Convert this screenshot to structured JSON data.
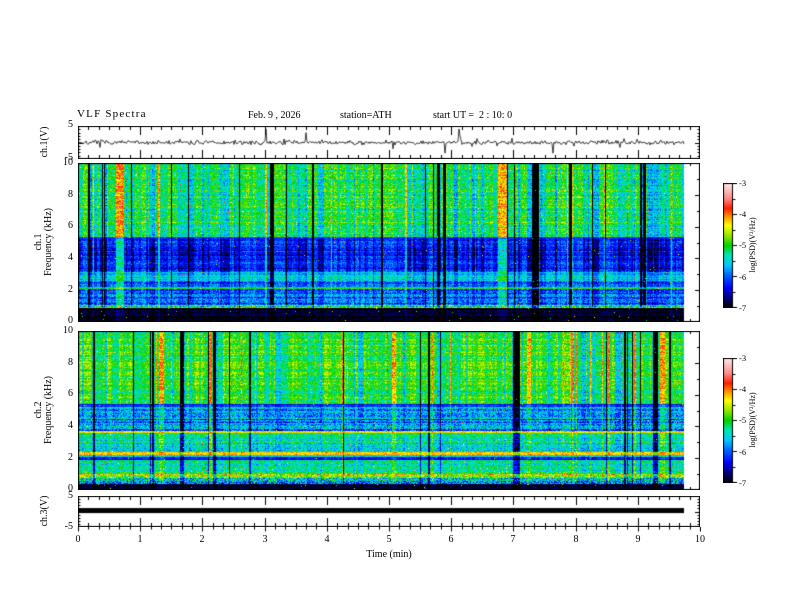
{
  "header": {
    "title": "VLF Spectra",
    "date": "Feb. 9 , 2026",
    "station": "station=ATH",
    "start_ut": "start UT =  2 : 10: 0"
  },
  "axes": {
    "time_label": "Time (min)",
    "x_ticks": [
      "0",
      "1",
      "2",
      "3",
      "4",
      "5",
      "6",
      "7",
      "8",
      "9",
      "10"
    ],
    "x_range_min": [
      0,
      10
    ],
    "x_minor_intervals_per_major": 6,
    "data_end_min": 9.75
  },
  "panels": {
    "wave1": {
      "ylabel": "ch.1(V)",
      "yticks": [
        "5",
        "-5"
      ],
      "yrange_V": [
        -5,
        5
      ]
    },
    "spec1": {
      "ylabel_line1": "ch.1",
      "ylabel_line2": "Frequency (kHz)",
      "yticks": [
        "10",
        "8",
        "6",
        "4",
        "2",
        "0"
      ],
      "yrange_kHz": [
        0,
        10
      ]
    },
    "spec2": {
      "ylabel_line1": "ch.2",
      "ylabel_line2": "Frequency (kHz)",
      "yticks": [
        "10",
        "8",
        "6",
        "4",
        "2",
        "0"
      ],
      "yrange_kHz": [
        0,
        10
      ]
    },
    "wave3": {
      "ylabel": "ch.3(V)",
      "yticks": [
        "5",
        "-5"
      ],
      "yrange_V": [
        -5,
        5
      ]
    }
  },
  "colorbar": {
    "label": "log(PSD)(V²/Hz)",
    "ticks": [
      "-3",
      "-4",
      "-5",
      "-6",
      "-7"
    ],
    "range": [
      -3,
      -7
    ],
    "palette": [
      [
        0.0,
        "#000000"
      ],
      [
        0.07,
        "#000070"
      ],
      [
        0.16,
        "#0000ff"
      ],
      [
        0.26,
        "#0064ff"
      ],
      [
        0.34,
        "#00c8ff"
      ],
      [
        0.42,
        "#00e6b4"
      ],
      [
        0.5,
        "#00d200"
      ],
      [
        0.58,
        "#96e600"
      ],
      [
        0.66,
        "#ffff00"
      ],
      [
        0.73,
        "#ff9600"
      ],
      [
        0.8,
        "#ff1e00"
      ],
      [
        0.88,
        "#ff8c8c"
      ],
      [
        1.0,
        "#ffe6e6"
      ]
    ]
  },
  "chart_data": [
    {
      "name": "ch1_voltage",
      "type": "line",
      "panel": "wave1",
      "ylabel": "ch.1(V)",
      "xlabel": "Time (min)",
      "x_range_min": [
        0,
        9.75
      ],
      "y_range_V": [
        -5,
        5
      ],
      "line_color": "#000000",
      "signal": {
        "baseline_V": 0,
        "noise_amp_V": 0.6,
        "spike_prob": 0.06,
        "spike_max_V": 4.8,
        "seed": 7,
        "desc": "dense black noise trace centered on 0 V with frequent narrow spikes up to about ±4.5 V, data ends near 9.75 min"
      }
    },
    {
      "name": "ch1_spectrogram",
      "type": "heatmap",
      "panel": "spec1",
      "ylabel": "ch.1 Frequency (kHz)",
      "xlabel": "Time (min)",
      "x_range_min": [
        0,
        9.75
      ],
      "freq_range_kHz": [
        0,
        10
      ],
      "value_range_logPSD": [
        -7,
        -3
      ],
      "seed": 11,
      "stripes": {
        "dark_prob": 0.06,
        "bright_prob": 0.05,
        "persist": 0.45,
        "desc": "vertical black dropout lines and bright yellow/cyan columns across all bands"
      },
      "bands": [
        {
          "f_kHz": [
            5.35,
            10.0
          ],
          "base": -5.1,
          "noise": 0.4,
          "stripe": 1.0,
          "desc": "green-cyan region with black and yellow vertical stripes"
        },
        {
          "f_kHz": [
            5.2,
            5.35
          ],
          "base": -6.1,
          "noise": 0.25,
          "stripe": 0.4,
          "desc": "dark horizontal line near 5.3 kHz"
        },
        {
          "f_kHz": [
            3.1,
            5.2
          ],
          "base": -6.25,
          "noise": 0.35,
          "stripe": 0.85,
          "desc": "dark blue region with cyan vertical stripes"
        },
        {
          "f_kHz": [
            2.55,
            3.1
          ],
          "base": -5.6,
          "noise": 0.3,
          "stripe": 0.55,
          "desc": "bright cyan band"
        },
        {
          "f_kHz": [
            2.16,
            2.55
          ],
          "base": -5.95,
          "noise": 0.4,
          "stripe": 0.55,
          "desc": "blue mottle"
        },
        {
          "f_kHz": [
            2.0,
            2.16
          ],
          "base": -5.05,
          "noise": 0.3,
          "stripe": 0.35,
          "desc": "green line near 2.1 kHz"
        },
        {
          "f_kHz": [
            1.0,
            2.0
          ],
          "base": -5.95,
          "noise": 0.45,
          "stripe": 0.55,
          "desc": "blue-cyan mottle"
        },
        {
          "f_kHz": [
            0.8,
            1.0
          ],
          "base": -5.0,
          "noise": 0.9,
          "stripe": 0.4,
          "desc": "speckled green-yellow line near 0.9 kHz"
        },
        {
          "f_kHz": [
            0.0,
            0.8
          ],
          "base": -6.95,
          "noise": 0.2,
          "stripe": 0.12,
          "desc": "black band at bottom"
        }
      ]
    },
    {
      "name": "ch2_spectrogram",
      "type": "heatmap",
      "panel": "spec2",
      "ylabel": "ch.2 Frequency (kHz)",
      "xlabel": "Time (min)",
      "x_range_min": [
        0,
        9.75
      ],
      "freq_range_kHz": [
        0,
        10
      ],
      "value_range_logPSD": [
        -7,
        -3
      ],
      "seed": 23,
      "stripes": {
        "dark_prob": 0.06,
        "bright_prob": 0.05,
        "persist": 0.45,
        "desc": "vertical black dropout lines and blue smears over green background"
      },
      "bands": [
        {
          "f_kHz": [
            5.4,
            10.0
          ],
          "base": -5.0,
          "noise": 0.35,
          "stripe": 1.0,
          "desc": "green region with black vertical stripes and blue patches"
        },
        {
          "f_kHz": [
            5.2,
            5.4
          ],
          "base": -6.2,
          "noise": 0.25,
          "stripe": 0.35,
          "desc": "dark horizontal line near 5.3 kHz"
        },
        {
          "f_kHz": [
            4.45,
            5.2
          ],
          "base": -5.7,
          "noise": 0.5,
          "stripe": 0.5,
          "desc": "blue speckled band"
        },
        {
          "f_kHz": [
            3.7,
            4.45
          ],
          "base": -5.85,
          "noise": 0.55,
          "stripe": 0.5,
          "desc": "blue mottled band with dark speckles"
        },
        {
          "f_kHz": [
            3.55,
            3.7
          ],
          "base": -4.4,
          "noise": 0.35,
          "stripe": 0.2,
          "desc": "orange-red horizontal line near 3.6 kHz"
        },
        {
          "f_kHz": [
            2.35,
            3.55
          ],
          "base": -5.3,
          "noise": 0.45,
          "stripe": 0.5,
          "desc": "green with blue mottling"
        },
        {
          "f_kHz": [
            2.15,
            2.35
          ],
          "base": -4.2,
          "noise": 0.3,
          "stripe": 0.2,
          "desc": "strong orange-red line near 2.2 kHz"
        },
        {
          "f_kHz": [
            2.05,
            2.15
          ],
          "base": -5.4,
          "noise": 0.3,
          "stripe": 0.3,
          "desc": "transition"
        },
        {
          "f_kHz": [
            1.8,
            2.05
          ],
          "base": -6.25,
          "noise": 0.35,
          "stripe": 0.3,
          "desc": "dark band near 1.9 kHz"
        },
        {
          "f_kHz": [
            0.95,
            1.8
          ],
          "base": -5.25,
          "noise": 0.4,
          "stripe": 0.45,
          "desc": "green band"
        },
        {
          "f_kHz": [
            0.7,
            0.95
          ],
          "base": -4.65,
          "noise": 0.7,
          "stripe": 0.3,
          "desc": "orange speckled line near 0.8 kHz"
        },
        {
          "f_kHz": [
            0.3,
            0.7
          ],
          "base": -5.45,
          "noise": 0.85,
          "stripe": 0.35,
          "desc": "green with dark speckles"
        },
        {
          "f_kHz": [
            0.0,
            0.3
          ],
          "base": -6.95,
          "noise": 0.2,
          "stripe": 0.1,
          "desc": "black band at bottom"
        }
      ]
    },
    {
      "name": "ch3_voltage",
      "type": "line",
      "panel": "wave3",
      "ylabel": "ch.3(V)",
      "xlabel": "Time (min)",
      "x_range_min": [
        0,
        9.75
      ],
      "y_range_V": [
        -5,
        5
      ],
      "line_color": "#000000",
      "signal": {
        "constant_V": 0.3,
        "bar_thickness_px": 5,
        "desc": "flat thick black bar slightly above 0 V, data ends near 9.75 min"
      }
    }
  ]
}
